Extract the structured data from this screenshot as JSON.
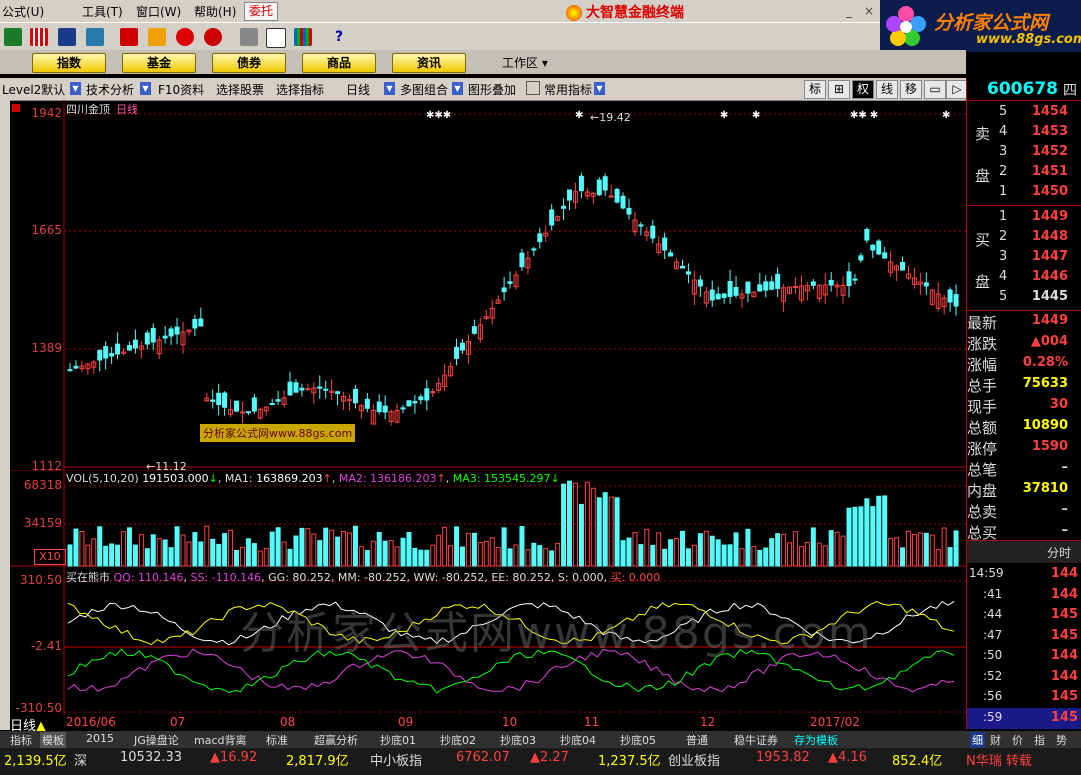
{
  "menu": [
    "公式(U)",
    "工具(T)",
    "窗口(W)",
    "帮助(H)"
  ],
  "weituo": "委托",
  "app_title": "大智慧金融终端",
  "brand": {
    "name": "分析家公式网",
    "url": "www.88gs.com"
  },
  "tabs": [
    "指数",
    "基金",
    "债券",
    "商品",
    "资讯"
  ],
  "workarea": "工作区",
  "toolbar2": {
    "level2": "Level2默认",
    "tech": "技术分析",
    "f10": "F10资料",
    "select_stock": "选择股票",
    "select_indicator": "选择指标",
    "daily": "日线",
    "multi": "多图组合",
    "overlay": "图形叠加",
    "common": "常用指标",
    "buttons": [
      "标",
      "⊞",
      "权",
      "线",
      "移",
      "▭",
      "▷"
    ]
  },
  "stock": {
    "code": "600678",
    "code_suffix": "四",
    "name": "四川金顶",
    "period": "日线"
  },
  "kline": {
    "axis": [
      "1942",
      "1665",
      "1389",
      "1112"
    ],
    "high_label": "19.42",
    "low_label": "11.12"
  },
  "vol": {
    "header": "VOL(5,10,20)",
    "v": "191503.000",
    "ma1_label": "MA1:",
    "ma1": "163869.203",
    "ma2_label": "MA2:",
    "ma2": "136186.203",
    "ma3_label": "MA3:",
    "ma3": "153545.297",
    "axis": [
      "68318",
      "34159"
    ],
    "unit": "X10"
  },
  "indicator": {
    "name": "买在熊市",
    "qq": "QQ: 110.146",
    "ss": "SS: -110.146",
    "gg": "GG: 80.252",
    "mm": "MM: -80.252",
    "ww": "WW: -80.252",
    "ee": "EE: 80.252",
    "s": "S: 0.000,",
    "buy": "买: 0.000",
    "axis": [
      "310.50",
      "-2.41",
      "-310.50"
    ]
  },
  "watermark": "分析家公式网www.88gs.com",
  "watermark_small": "分析家公式网www.88gs.com",
  "dates": [
    "2016/06",
    "07",
    "08",
    "09",
    "10",
    "11",
    "12",
    "2017/02"
  ],
  "period_label": "日线",
  "orderbook": {
    "sell_label": [
      "卖",
      "盘"
    ],
    "buy_label": [
      "买",
      "盘"
    ],
    "sell": [
      {
        "lvl": "5",
        "price": "1454"
      },
      {
        "lvl": "4",
        "price": "1453"
      },
      {
        "lvl": "3",
        "price": "1452"
      },
      {
        "lvl": "2",
        "price": "1451"
      },
      {
        "lvl": "1",
        "price": "1450"
      }
    ],
    "buy": [
      {
        "lvl": "1",
        "price": "1449"
      },
      {
        "lvl": "2",
        "price": "1448"
      },
      {
        "lvl": "3",
        "price": "1447"
      },
      {
        "lvl": "4",
        "price": "1446"
      },
      {
        "lvl": "5",
        "price": "1445"
      }
    ]
  },
  "quote": [
    {
      "label": "最新",
      "value": "1449",
      "color": "#ff4040"
    },
    {
      "label": "涨跌",
      "value": "▲004",
      "color": "#ff4040"
    },
    {
      "label": "涨幅",
      "value": "0.28%",
      "color": "#ff4040"
    },
    {
      "label": "总手",
      "value": "75633",
      "color": "#ffff00"
    },
    {
      "label": "现手",
      "value": "30",
      "color": "#ff4040"
    },
    {
      "label": "总额",
      "value": "10890",
      "color": "#ffff00"
    },
    {
      "label": "涨停",
      "value": "1590",
      "color": "#ff4040"
    },
    {
      "label": "总笔",
      "value": "–",
      "color": "#ddd"
    },
    {
      "label": "内盘",
      "value": "37810",
      "color": "#ffff00"
    },
    {
      "label": "总卖",
      "value": "–",
      "color": "#ddd"
    },
    {
      "label": "总买",
      "value": "–",
      "color": "#ddd"
    }
  ],
  "timeshare_title": "分时",
  "ticks": [
    {
      "t": "14:59",
      "p": "144"
    },
    {
      "t": ":41",
      "p": "144"
    },
    {
      "t": ":44",
      "p": "145"
    },
    {
      "t": ":47",
      "p": "145"
    },
    {
      "t": ":50",
      "p": "144"
    },
    {
      "t": ":52",
      "p": "144"
    },
    {
      "t": ":56",
      "p": "145"
    },
    {
      "t": ":59",
      "p": "145"
    }
  ],
  "rp_bottom_tabs": [
    "细",
    "财",
    "价",
    "指",
    "势"
  ],
  "bottom_tabs": [
    "指标",
    "模板",
    "2015",
    "JG操盘论",
    "macd背离",
    "标准",
    "超赢分析",
    "抄底01",
    "抄底02",
    "抄底03",
    "抄底04",
    "抄底05",
    "普通",
    "稳牛证券",
    "存为模板"
  ],
  "status": [
    {
      "text": "2,139.5亿",
      "color": "#ffff00"
    },
    {
      "text": "深",
      "color": "#ddd"
    },
    {
      "text": "10532.33",
      "color": "#ddd"
    },
    {
      "text": "▲16.92",
      "color": "#ff4040"
    },
    {
      "text": "2,817.9亿",
      "color": "#ffff00"
    },
    {
      "text": "中小板指",
      "color": "#ddd"
    },
    {
      "text": "6762.07",
      "color": "#ff4040"
    },
    {
      "text": "▲2.27",
      "color": "#ff4040"
    },
    {
      "text": "1,237.5亿",
      "color": "#ffff00"
    },
    {
      "text": "创业板指",
      "color": "#ddd"
    },
    {
      "text": "1953.82",
      "color": "#ff4040"
    },
    {
      "text": "▲4.16",
      "color": "#ff4040"
    },
    {
      "text": "852.4亿",
      "color": "#ffff00"
    },
    {
      "text": "N华瑞 转载",
      "color": "#ff4040"
    }
  ]
}
